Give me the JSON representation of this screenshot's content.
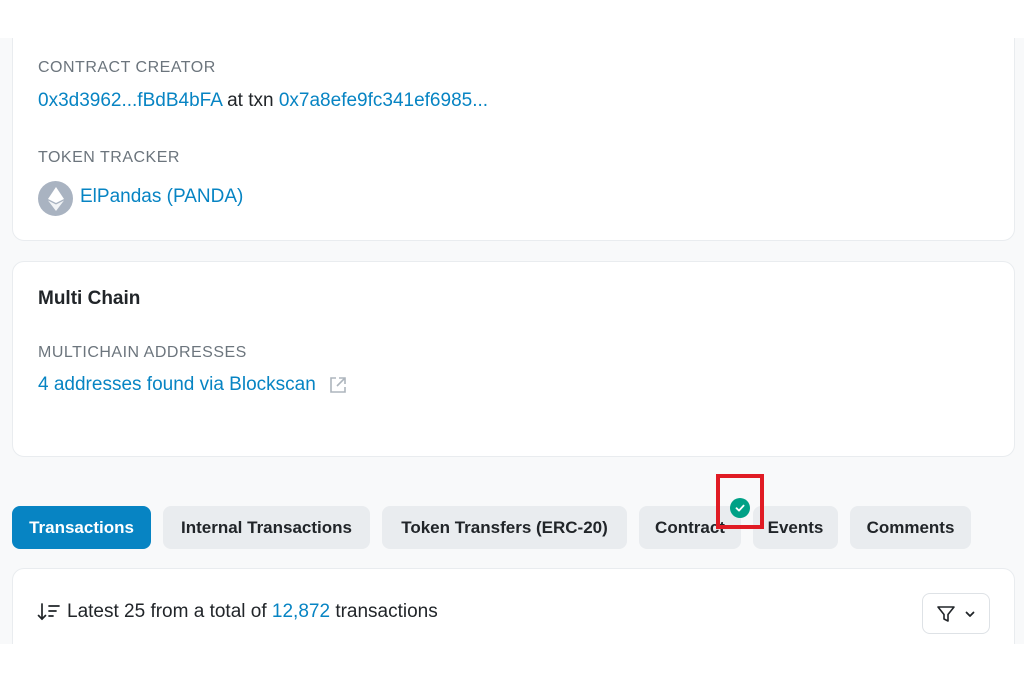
{
  "contract_creator": {
    "label": "CONTRACT CREATOR",
    "creator_address": "0x3d3962...fBdB4bFA",
    "at_txn_text": "at txn",
    "txn_hash": "0x7a8efe9fc341ef6985..."
  },
  "token_tracker": {
    "label": "TOKEN TRACKER",
    "token_name": "ElPandas (PANDA)",
    "icon": "ethereum-icon"
  },
  "multi_chain": {
    "title": "Multi Chain",
    "label": "MULTICHAIN ADDRESSES",
    "link_text": "4 addresses found via Blockscan",
    "link_icon": "external-link-icon"
  },
  "tabs": [
    {
      "label": "Transactions",
      "active": true
    },
    {
      "label": "Internal Transactions",
      "active": false
    },
    {
      "label": "Token Transfers (ERC-20)",
      "active": false
    },
    {
      "label": "Contract",
      "active": false
    },
    {
      "label": "Events",
      "active": false
    },
    {
      "label": "Comments",
      "active": false
    }
  ],
  "summary": {
    "prefix": "Latest 25 from a total of",
    "count": "12,872",
    "suffix": "transactions",
    "sort_icon": "sort-descending-icon",
    "filter_icon": "filter-icon"
  },
  "colors": {
    "link": "#0784c3",
    "verified_badge": "#00a186",
    "highlight_box": "#e01b24"
  }
}
